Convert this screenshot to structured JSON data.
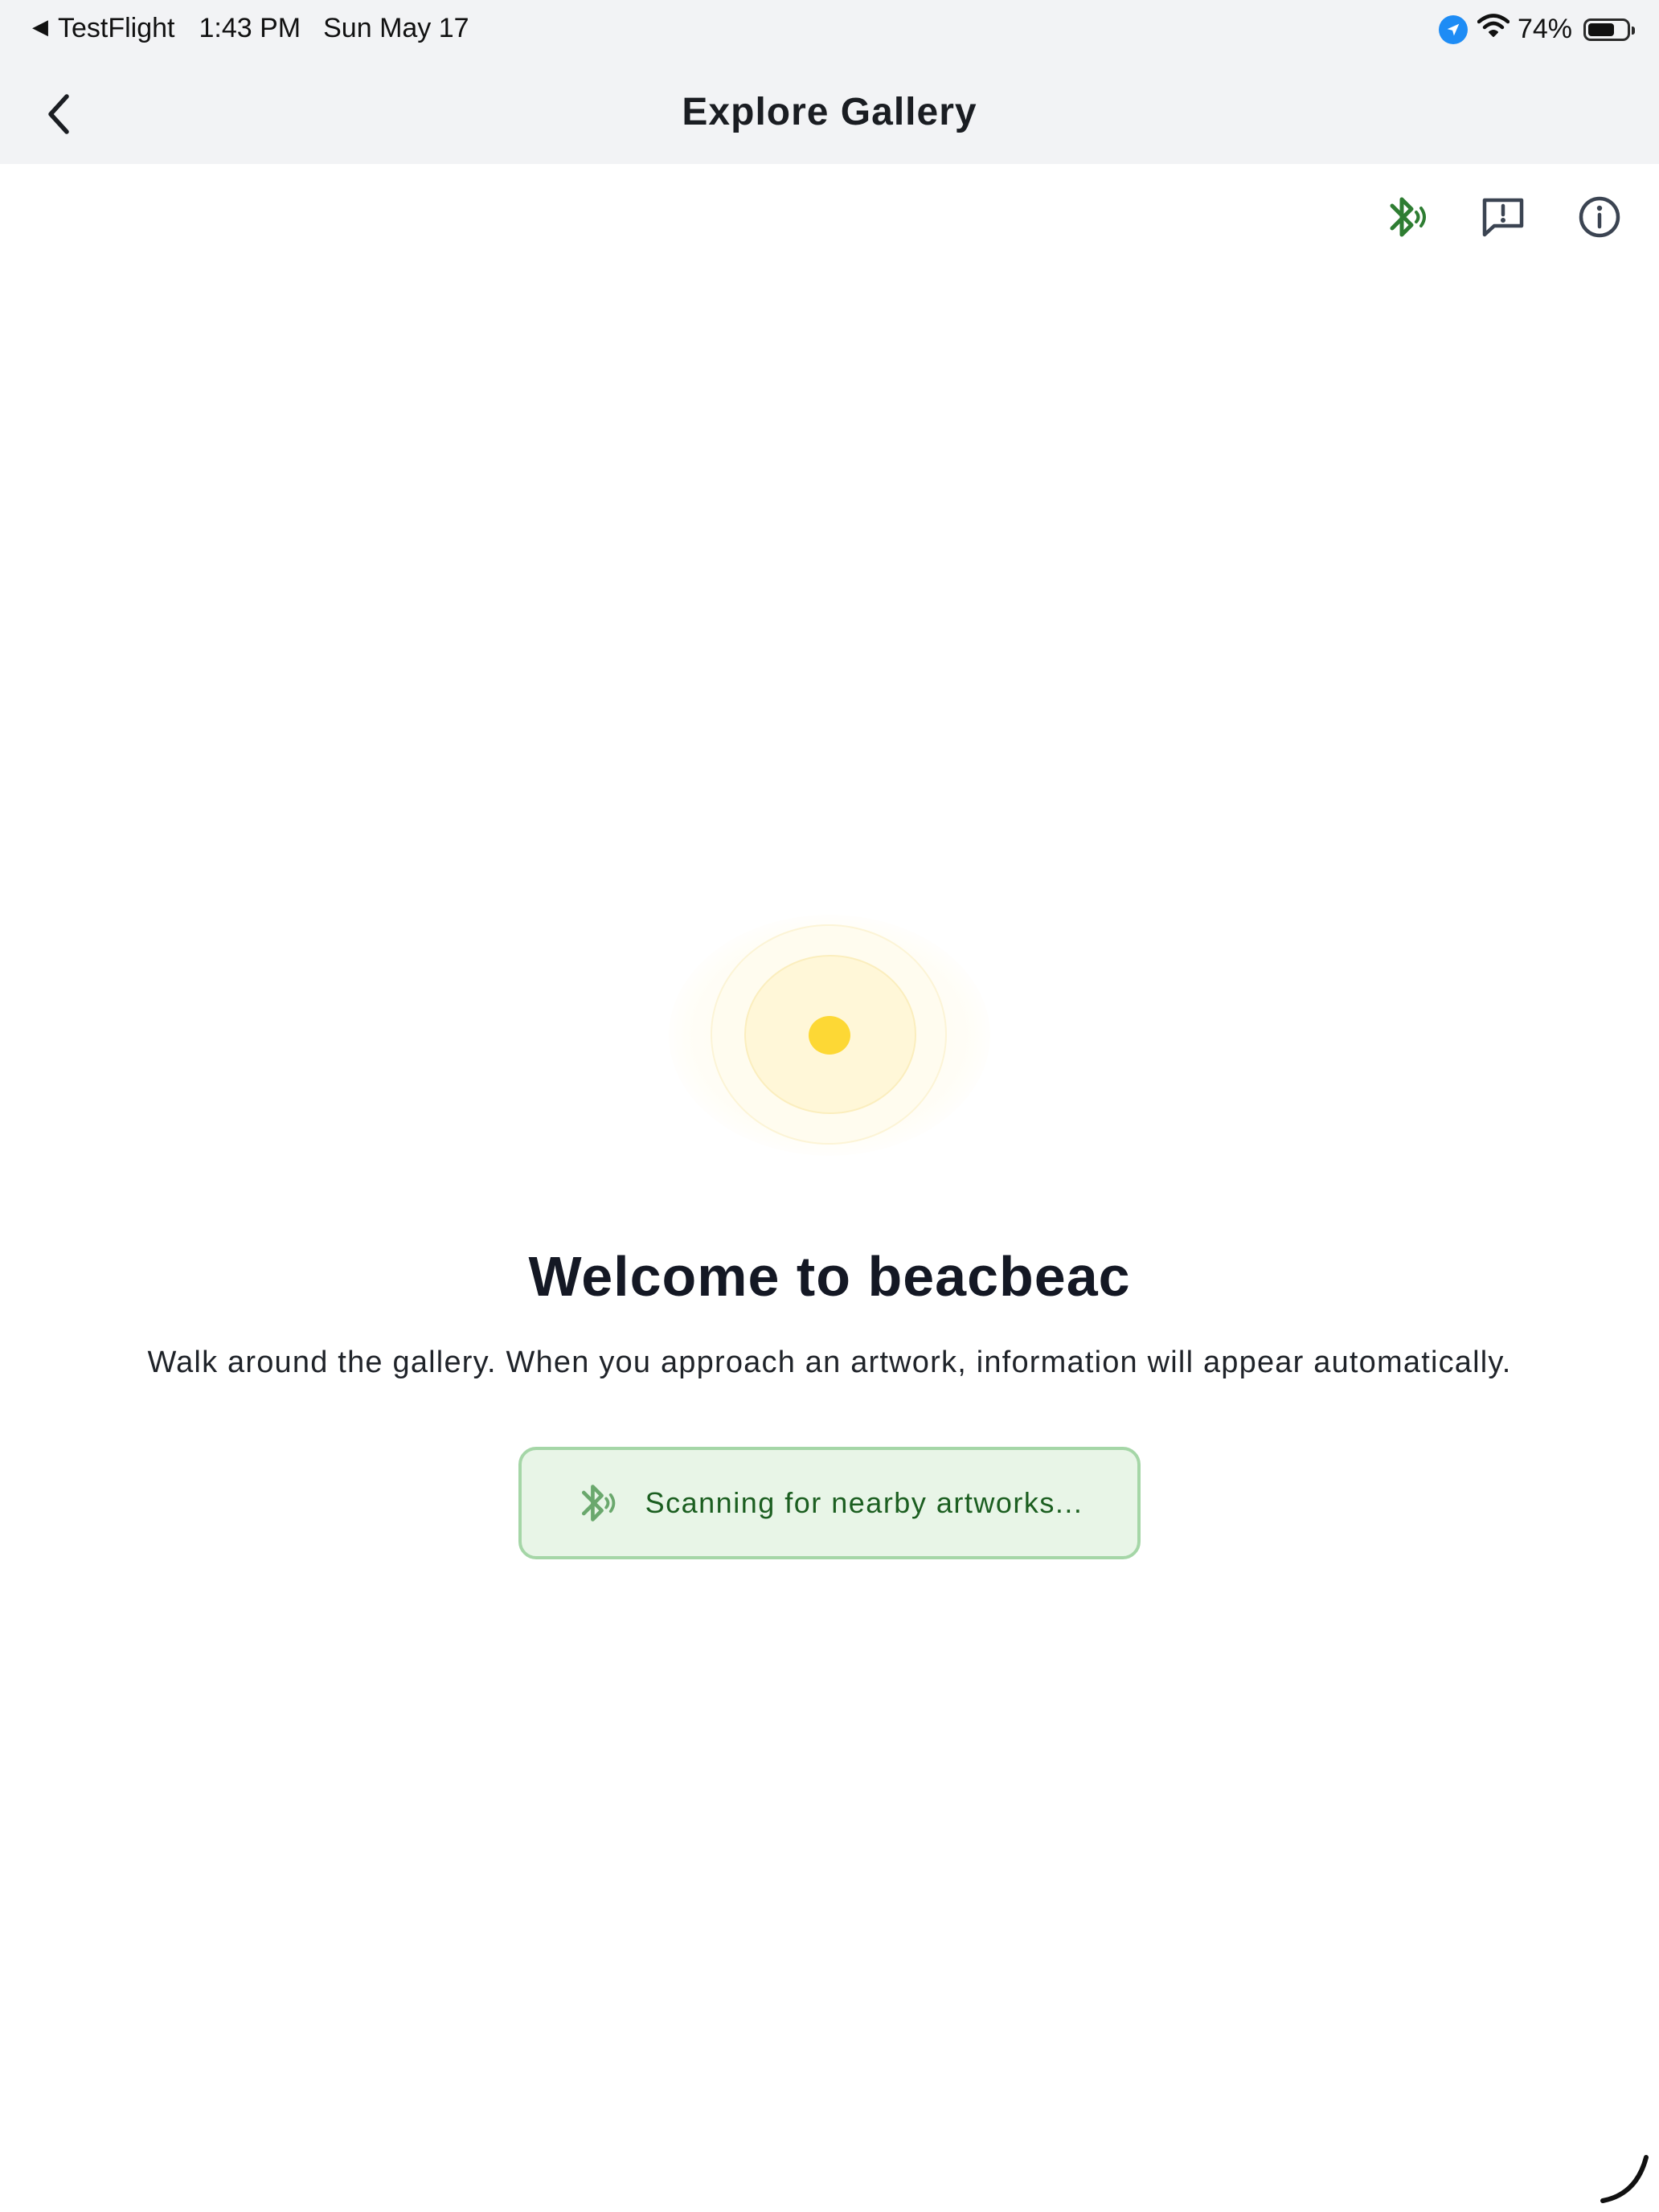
{
  "status_bar": {
    "back_app": "TestFlight",
    "time": "1:43 PM",
    "date": "Sun May 17",
    "battery": "74%",
    "battery_level": 0.74
  },
  "nav": {
    "title": "Explore Gallery",
    "back_icon": "chevron-left-icon"
  },
  "toolbar": {
    "icons": [
      "bluetooth-scanning-icon",
      "feedback-icon",
      "info-icon"
    ]
  },
  "main": {
    "title": "Welcome to beacbeac",
    "subtitle": "Walk around the gallery. When you approach an artwork, information will appear automatically.",
    "scan_status": "Scanning for nearby artworks..."
  },
  "colors": {
    "nav_background": "#f2f3f5",
    "bluetooth_active": "#2e7d32",
    "beacon_core": "#fdd835",
    "scan_pill_background": "#e8f5e7",
    "scan_pill_border": "#a5d6a7",
    "scan_text": "#1b5e20",
    "location_badge": "#1e8cf5"
  }
}
